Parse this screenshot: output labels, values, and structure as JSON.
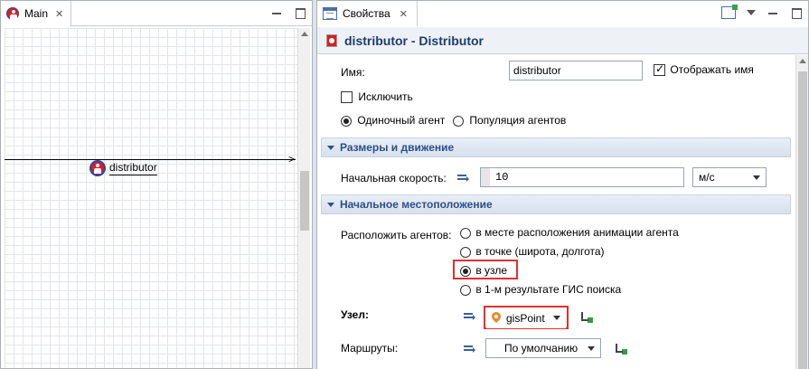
{
  "left_tab": {
    "label": "Main"
  },
  "canvas": {
    "agent_label": "distributor"
  },
  "right_tab": {
    "label": "Свойства"
  },
  "header": {
    "title": "distributor - Distributor"
  },
  "fields": {
    "name_label": "Имя:",
    "name_value": "distributor",
    "show_name_label": "Отображать имя",
    "exclude_label": "Исключить",
    "single_agent_label": "Одиночный агент",
    "population_label": "Популяция агентов"
  },
  "section_size": {
    "label": "Размеры и движение"
  },
  "speed": {
    "label": "Начальная скорость:",
    "value": "10",
    "unit": "м/с"
  },
  "section_location": {
    "label": "Начальное местоположение"
  },
  "placement": {
    "label": "Расположить агентов:",
    "options": [
      "в месте расположения анимации агента",
      "в точке (широта, долгота)",
      "в узле",
      "в 1-м результате ГИС поиска"
    ],
    "selected": "в узле"
  },
  "node": {
    "label": "Узел:",
    "value": "gisPoint"
  },
  "routes": {
    "label": "Маршруты:",
    "value": "По умолчанию"
  },
  "colors": {
    "accent": "#2b4f87",
    "highlight": "#e03131",
    "agent": "#d71f1f"
  }
}
